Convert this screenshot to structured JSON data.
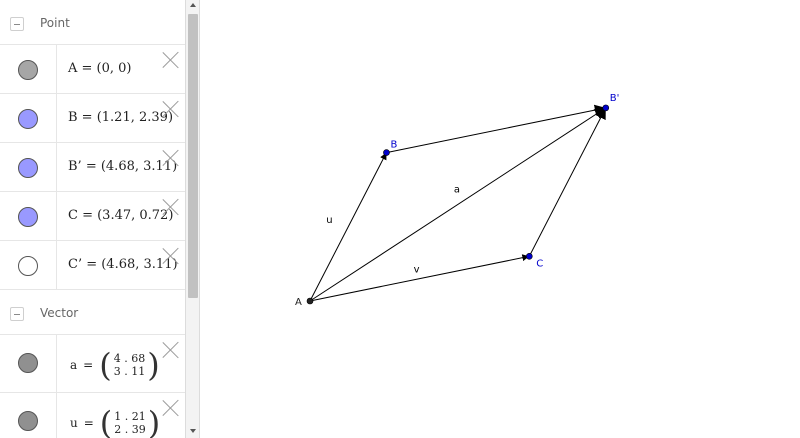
{
  "algebra": {
    "groups": [
      {
        "title": "Point",
        "items": [
          {
            "text": "A = (0, 0)",
            "color": "#a6a6a6"
          },
          {
            "text": "B = (1.21, 2.39)",
            "color": "#9999ff"
          },
          {
            "text": "B’ = (4.68, 3.11)",
            "color": "#9999ff"
          },
          {
            "text": "C = (3.47, 0.72)",
            "color": "#9999ff"
          },
          {
            "text": "C’ = (4.68, 3.11)",
            "color": "#ffffff"
          }
        ]
      },
      {
        "title": "Vector",
        "items": [
          {
            "name": "a",
            "eq": "=",
            "r1": "4 . 68",
            "r2": "3 . 11",
            "color": "#909090"
          },
          {
            "name": "u",
            "eq": "=",
            "r1": "1 . 21",
            "r2": "2 . 39",
            "color": "#909090"
          }
        ]
      }
    ]
  },
  "graphics": {
    "points": [
      {
        "label": "A",
        "x": 0,
        "y": 0,
        "color": "#222222",
        "labelColor": "#222222"
      },
      {
        "label": "B",
        "x": 1.21,
        "y": 2.39,
        "color": "#0000cc",
        "labelColor": "#0000cc"
      },
      {
        "label": "B'",
        "x": 4.68,
        "y": 3.11,
        "color": "#0000cc",
        "labelColor": "#0000cc"
      },
      {
        "label": "C",
        "x": 3.47,
        "y": 0.72,
        "color": "#0000cc",
        "labelColor": "#0000cc"
      }
    ],
    "vectors": [
      {
        "name": "u",
        "from": "A",
        "to": "B"
      },
      {
        "name": "v",
        "from": "A",
        "to": "C"
      },
      {
        "name": "a",
        "from": "A",
        "to": "B'"
      },
      {
        "name": "",
        "from": "B",
        "to": "B'"
      },
      {
        "name": "",
        "from": "C",
        "to": "B'"
      }
    ]
  }
}
